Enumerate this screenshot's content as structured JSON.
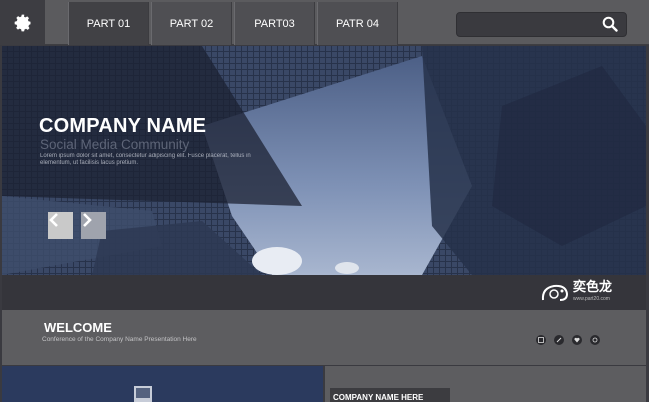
{
  "header": {
    "nav": [
      {
        "label": "PART 01",
        "active": true
      },
      {
        "label": "PART 02",
        "active": false
      },
      {
        "label": "PART03",
        "active": false
      },
      {
        "label": "PATR 04",
        "active": false
      }
    ],
    "search": {
      "placeholder": "",
      "icon": "search-icon"
    },
    "settings_icon": "gear-icon"
  },
  "hero": {
    "title": "COMPANY NAME",
    "subtitle": "Social Media Community",
    "body": "Lorem ipsum dolor sit amet, consectetur adipiscing elit. Fusce placerat, tellus in elementum, ut facilisis lacus pretium.",
    "prev_icon": "chevron-left-icon",
    "next_icon": "chevron-right-icon"
  },
  "brand": {
    "name": "奕色龙",
    "url": "www.part20.com"
  },
  "welcome": {
    "title": "WELCOME",
    "subtitle": "Conference of the Company Name Presentation Here",
    "social_icons": [
      "rss-icon",
      "link-icon",
      "heart-icon",
      "share-icon"
    ]
  },
  "bottom": {
    "label": "COMPANY NAME HERE"
  },
  "colors": {
    "topbar": "#5b5b5e",
    "dark": "#35353b",
    "panel": "#5d5d60",
    "accent": "#ffffff"
  }
}
